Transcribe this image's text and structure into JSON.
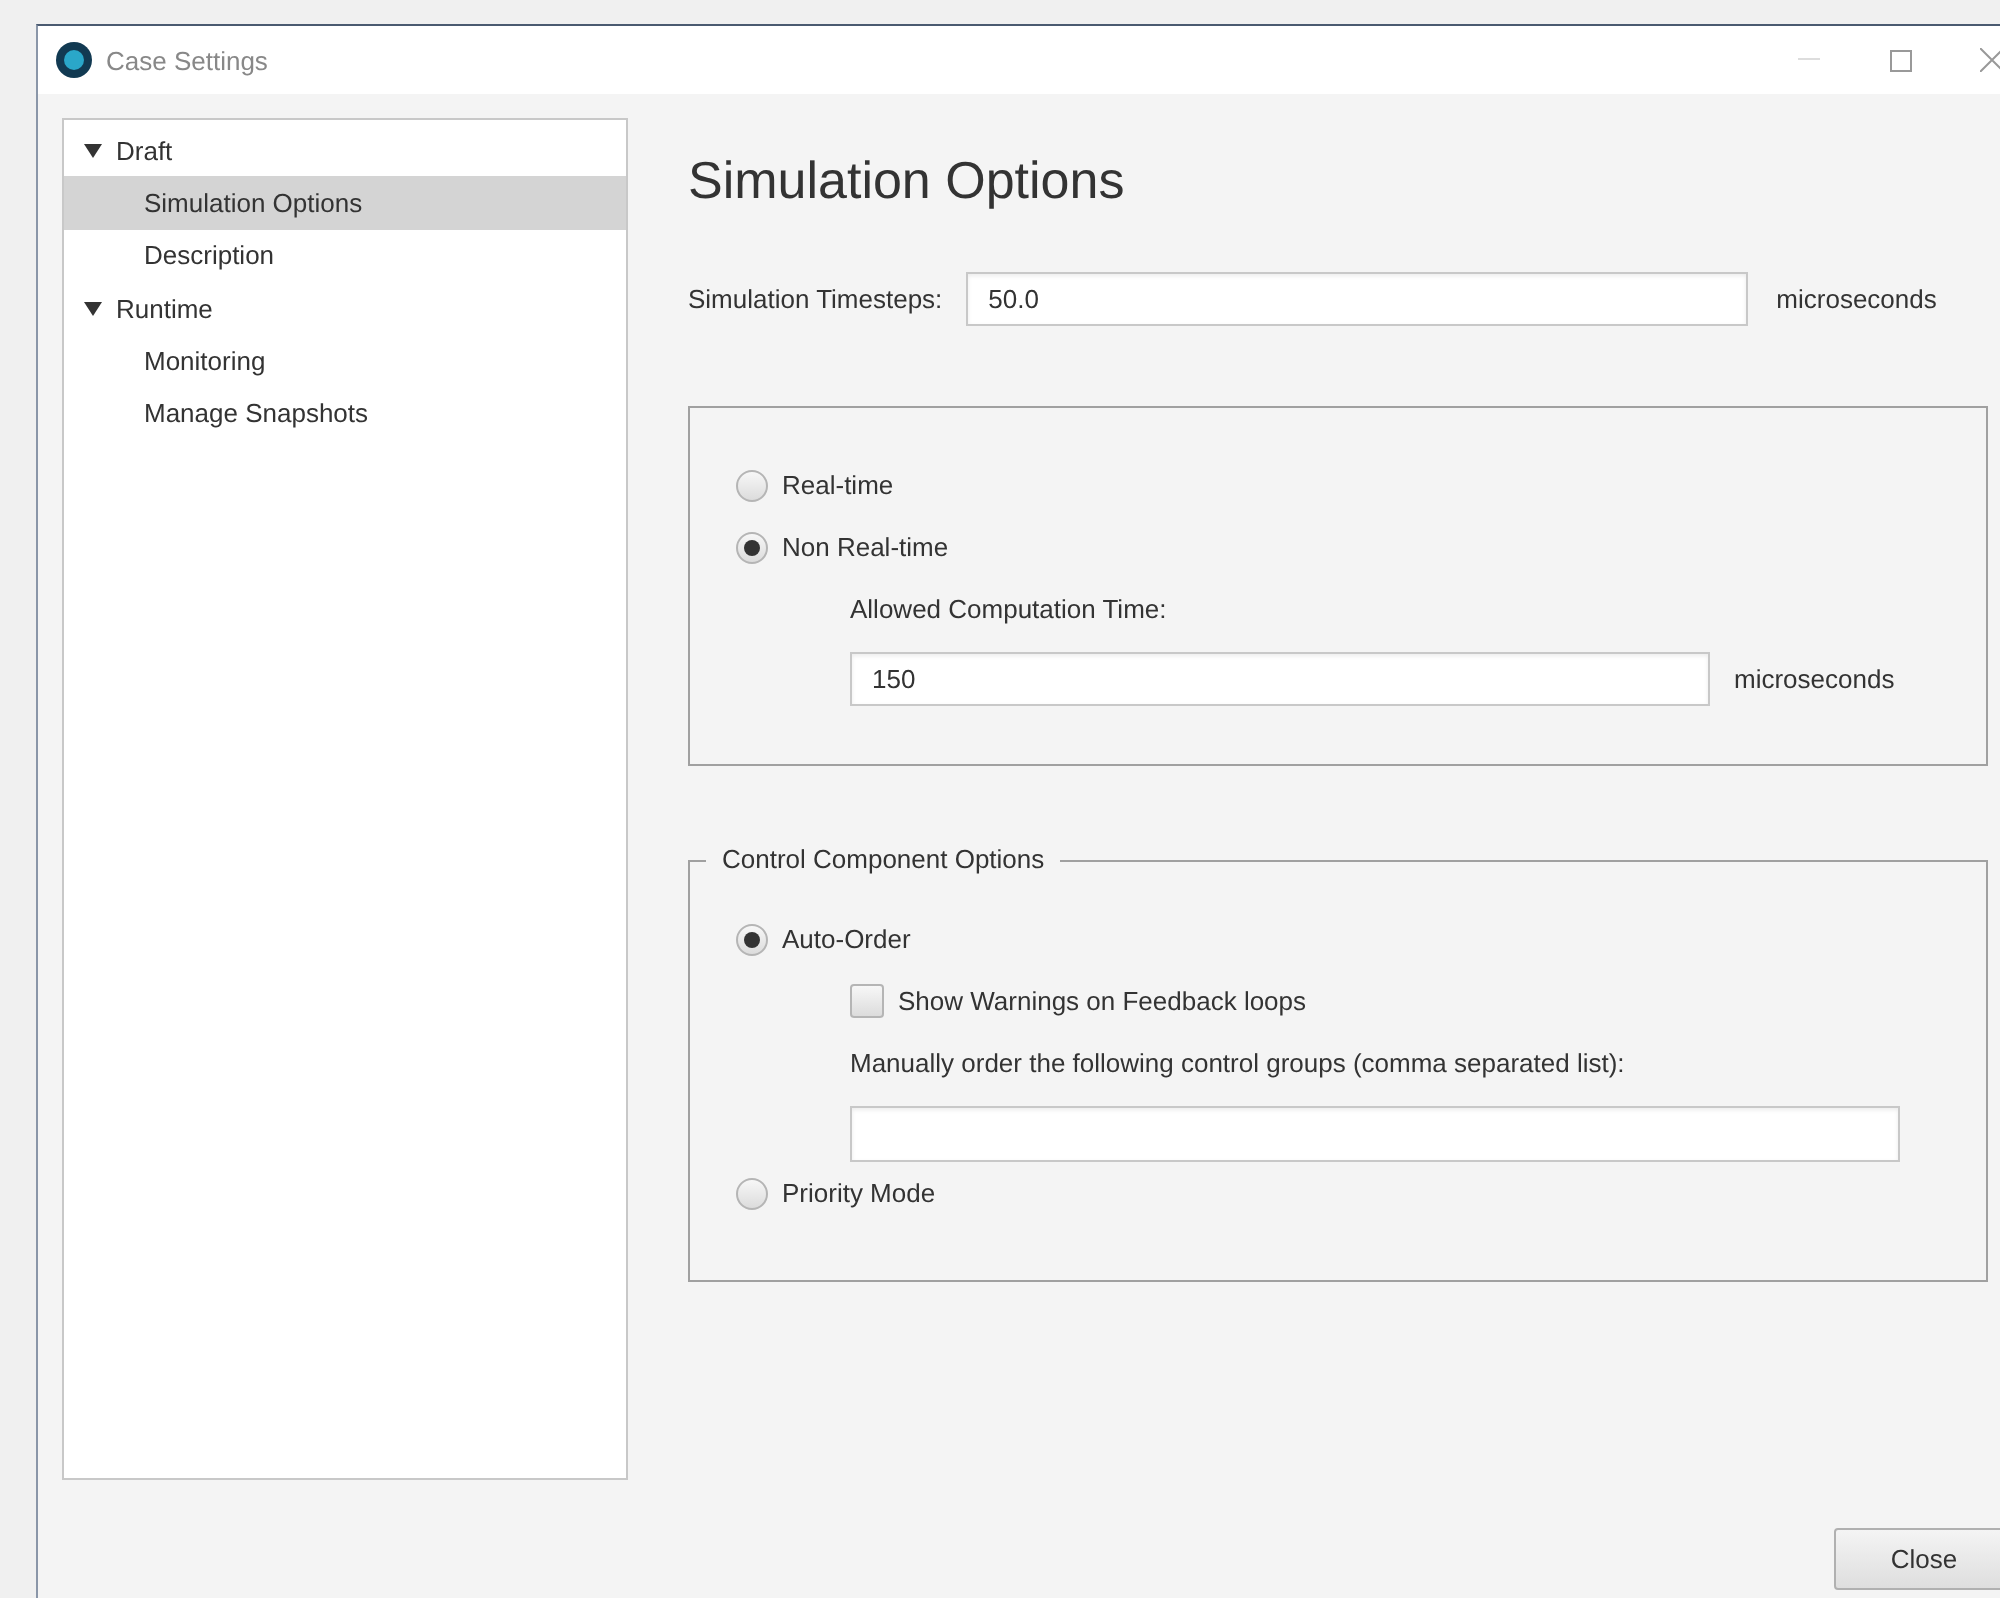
{
  "window": {
    "title": "Case Settings"
  },
  "tree": [
    {
      "label": "Draft",
      "expanded": true,
      "selected": false,
      "children": [
        {
          "label": "Simulation Options",
          "selected": true
        },
        {
          "label": "Description",
          "selected": false
        }
      ]
    },
    {
      "label": "Runtime",
      "expanded": true,
      "selected": false,
      "children": [
        {
          "label": "Monitoring",
          "selected": false
        },
        {
          "label": "Manage Snapshots",
          "selected": false
        }
      ]
    }
  ],
  "heading": "Simulation Options",
  "timesteps": {
    "label": "Simulation Timesteps:",
    "value": "50.0",
    "unit": "microseconds"
  },
  "mode_group": {
    "options": [
      {
        "label": "Real-time",
        "selected": false
      },
      {
        "label": "Non Real-time",
        "selected": true
      }
    ],
    "computation": {
      "label": "Allowed Computation Time:",
      "value": "150",
      "unit": "microseconds"
    }
  },
  "control_group": {
    "title": "Control Component Options",
    "options": [
      {
        "label": "Auto-Order",
        "selected": true
      },
      {
        "label": "Priority Mode",
        "selected": false
      }
    ],
    "warnings": {
      "label": "Show Warnings on Feedback loops",
      "checked": false
    },
    "manual": {
      "label": "Manually order the following control groups (comma separated list):"
    }
  },
  "buttons": [
    {
      "label": "Close"
    }
  ]
}
